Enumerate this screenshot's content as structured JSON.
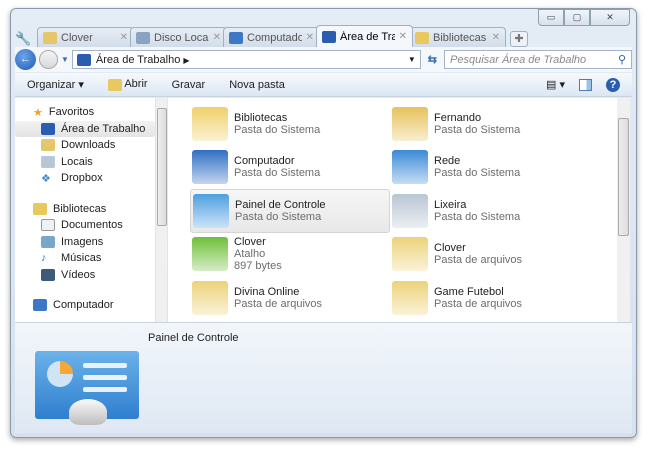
{
  "window": {
    "controls": [
      "▭",
      "▢",
      "✕"
    ]
  },
  "tabs": [
    {
      "label": "Clover",
      "color": "#e5c66a"
    },
    {
      "label": "Disco Local ...",
      "color": "#8aa3c2"
    },
    {
      "label": "Computador",
      "color": "#3c78c6"
    },
    {
      "label": "Área de Traba...",
      "color": "#2a5db0",
      "active": true
    },
    {
      "label": "Bibliotecas",
      "color": "#e9c95f"
    }
  ],
  "address": {
    "path": "Área de Trabalho",
    "search_placeholder": "Pesquisar Área de Trabalho"
  },
  "toolbar": {
    "organize": "Organizar ▾",
    "open": "Abrir",
    "burn": "Gravar",
    "new_folder": "Nova pasta"
  },
  "sidebar": {
    "favorites": "Favoritos",
    "fav_items": [
      "Área de Trabalho",
      "Downloads",
      "Locais",
      "Dropbox"
    ],
    "libraries": "Bibliotecas",
    "lib_items": [
      "Documentos",
      "Imagens",
      "Músicas",
      "Vídeos"
    ],
    "computer": "Computador"
  },
  "items": [
    {
      "name": "Bibliotecas",
      "sub": "Pasta do Sistema",
      "color": "#f0d06a"
    },
    {
      "name": "Fernando",
      "sub": "Pasta do Sistema",
      "color": "#e7c25b"
    },
    {
      "name": "Computador",
      "sub": "Pasta do Sistema",
      "color": "#2f6fc4"
    },
    {
      "name": "Rede",
      "sub": "Pasta do Sistema",
      "color": "#3a8ad6"
    },
    {
      "name": "Painel de Controle",
      "sub": "Pasta do Sistema",
      "color": "#4d9ee0"
    },
    {
      "name": "Lixeira",
      "sub": "Pasta do Sistema",
      "color": "#b9c6d3"
    },
    {
      "name": "Clover",
      "sub": "Atalho",
      "sub2": "897 bytes",
      "color": "#6fbf3a"
    },
    {
      "name": "Clover",
      "sub": "Pasta de arquivos",
      "color": "#ecd27a"
    },
    {
      "name": "Divina Online",
      "sub": "Pasta de arquivos",
      "color": "#ecd27a"
    },
    {
      "name": "Game Futebol",
      "sub": "Pasta de arquivos",
      "color": "#ecd27a"
    }
  ],
  "details": {
    "name": "Painel de Controle"
  }
}
